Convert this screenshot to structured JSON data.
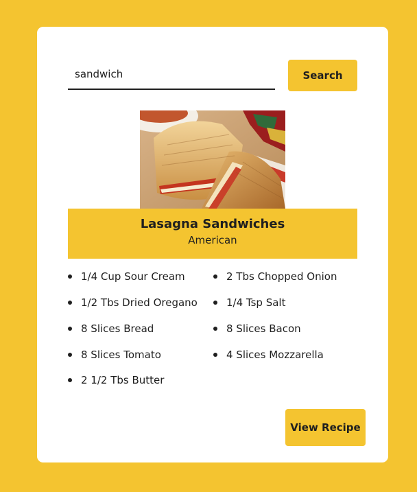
{
  "search": {
    "value": "sandwich",
    "button_label": "Search"
  },
  "recipe": {
    "title": "Lasagna Sandwiches",
    "cuisine": "American",
    "ingredients": [
      "1/4 Cup Sour Cream",
      "2 Tbs Chopped Onion",
      "1/2 Tbs Dried Oregano",
      "1/4 Tsp Salt",
      "8 Slices Bread",
      "8 Slices Bacon",
      "8 Slices Tomato",
      "4 Slices Mozzarella",
      "2 1/2 Tbs Butter"
    ],
    "view_button_label": "View Recipe"
  },
  "colors": {
    "accent": "#f4c430",
    "card": "#ffffff",
    "text": "#1f1f1f"
  }
}
